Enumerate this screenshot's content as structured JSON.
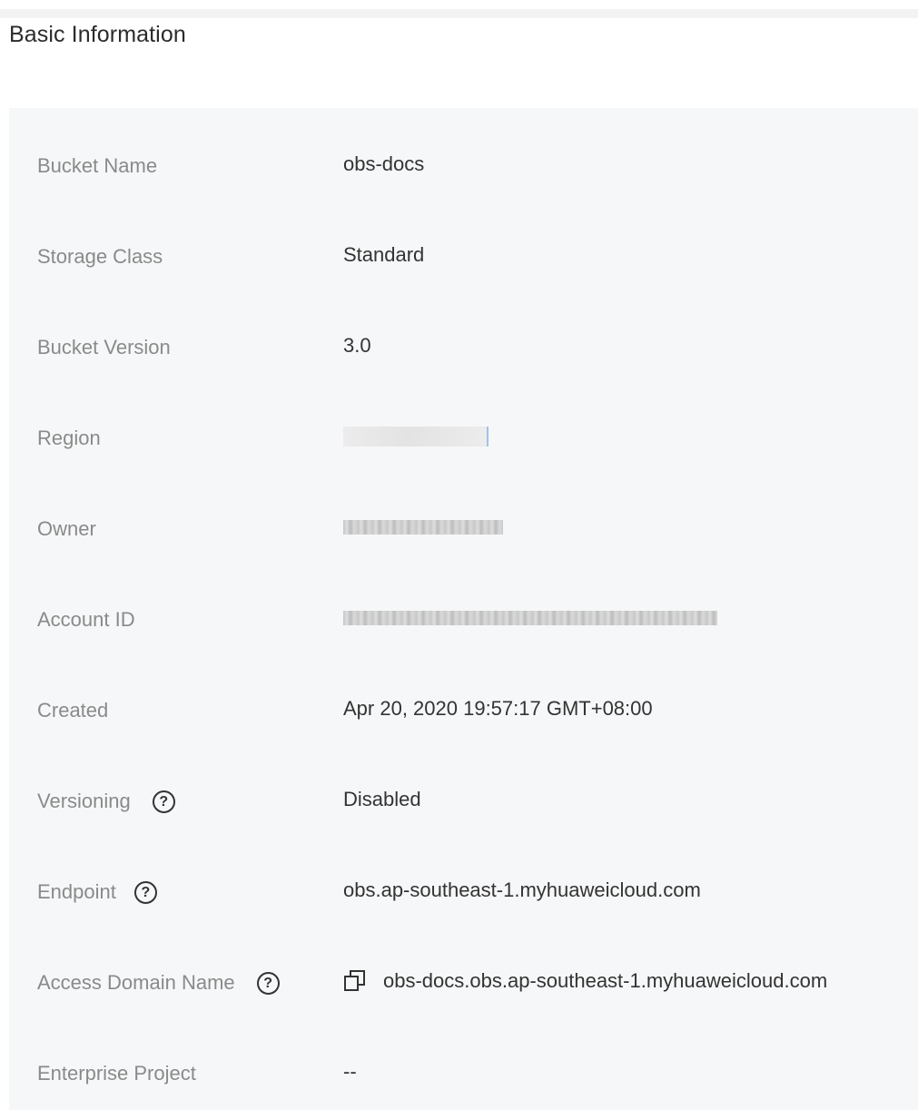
{
  "section": {
    "title": "Basic Information"
  },
  "fields": [
    {
      "label": "Bucket Name",
      "value": "obs-docs"
    },
    {
      "label": "Storage Class",
      "value": "Standard"
    },
    {
      "label": "Bucket Version",
      "value": "3.0"
    },
    {
      "label": "Region",
      "value": ""
    },
    {
      "label": "Owner",
      "value": ""
    },
    {
      "label": "Account ID",
      "value": ""
    },
    {
      "label": "Created",
      "value": "Apr 20, 2020 19:57:17 GMT+08:00"
    },
    {
      "label": "Versioning",
      "value": "Disabled"
    },
    {
      "label": "Endpoint",
      "value": "obs.ap-southeast-1.myhuaweicloud.com"
    },
    {
      "label": "Access Domain Name",
      "value": "obs-docs.obs.ap-southeast-1.myhuaweicloud.com"
    },
    {
      "label": "Enterprise Project",
      "value": "--"
    }
  ],
  "icons": {
    "help": "help-circle-icon",
    "help_glyph": "?",
    "copy": "copy-icon"
  },
  "colors": {
    "panel_bg": "#f6f7f8",
    "label": "#8a8a8a",
    "value": "#333333",
    "title": "#2b2b2b"
  }
}
